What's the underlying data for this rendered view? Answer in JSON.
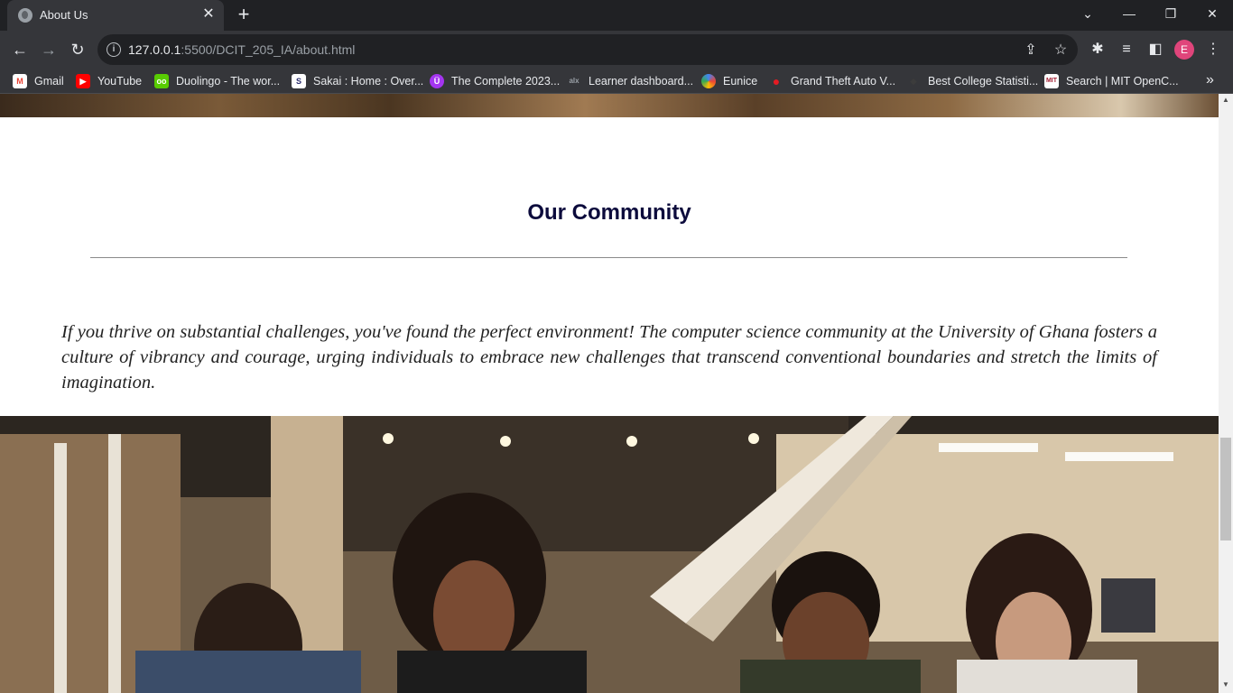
{
  "browser": {
    "tab": {
      "title": "About Us",
      "close_label": "✕"
    },
    "new_tab_label": "+",
    "window_controls": {
      "tab_search": "⌄",
      "minimize": "—",
      "restore": "❐",
      "close": "✕"
    },
    "nav": {
      "back": "←",
      "forward": "→",
      "reload": "↻"
    },
    "address": {
      "host": "127.0.0.1",
      "rest": ":5500/DCIT_205_IA/about.html"
    },
    "profile_initial": "E",
    "bookmarks": [
      {
        "label": "Gmail",
        "icon": "gmail-icon",
        "color": "#ea4335",
        "glyph": "M"
      },
      {
        "label": "YouTube",
        "icon": "youtube-icon",
        "color": "#ff0000",
        "glyph": "▶"
      },
      {
        "label": "Duolingo - The wor...",
        "icon": "duolingo-icon",
        "color": "#58cc02",
        "glyph": "oo"
      },
      {
        "label": "Sakai : Home : Over...",
        "icon": "sakai-icon",
        "color": "#2b2d6e",
        "glyph": "S"
      },
      {
        "label": "The Complete 2023...",
        "icon": "udemy-icon",
        "color": "#a435f0",
        "glyph": "Ü"
      },
      {
        "label": "Learner dashboard...",
        "icon": "alx-icon",
        "color": "#3a3a3a",
        "glyph": "alx"
      },
      {
        "label": "Eunice",
        "icon": "eunice-icon",
        "color": "#4285f4",
        "glyph": "◎"
      },
      {
        "label": "Grand Theft Auto V...",
        "icon": "gta-icon",
        "color": "#e31b23",
        "glyph": "●"
      },
      {
        "label": "Best College Statisti...",
        "icon": "college-icon",
        "color": "#3c3c3c",
        "glyph": "◆"
      },
      {
        "label": "Search | MIT OpenC...",
        "icon": "mit-icon",
        "color": "#a31f34",
        "glyph": "MIT"
      }
    ],
    "bookmarks_more": "»"
  },
  "page": {
    "section_title": "Our Community",
    "section_text": "If you thrive on substantial challenges, you've found the perfect environment! The computer science community at the University of Ghana fosters a culture of vibrancy and courage, urging individuals to embrace new challenges that transcend conventional boundaries and stretch the limits of imagination."
  }
}
